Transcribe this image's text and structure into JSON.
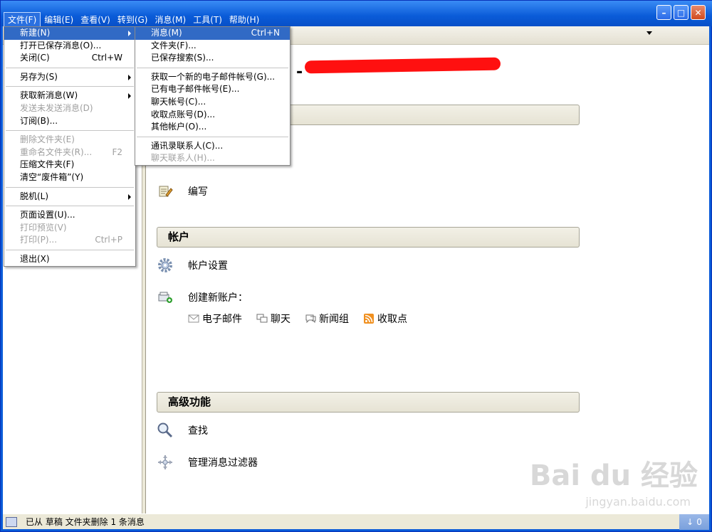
{
  "menubar": [
    {
      "label": "文件(F)",
      "active": true
    },
    {
      "label": "编辑(E)"
    },
    {
      "label": "查看(V)"
    },
    {
      "label": "转到(G)"
    },
    {
      "label": "消息(M)"
    },
    {
      "label": "工具(T)"
    },
    {
      "label": "帮助(H)"
    }
  ],
  "file_menu": {
    "new": "新建(N)",
    "open_saved": "打开已保存消息(O)...",
    "close": "关闭(C)",
    "close_acc": "Ctrl+W",
    "save_as": "另存为(S)",
    "get_new": "获取新消息(W)",
    "send_unsent": "发送未发送消息(D)",
    "subscribe": "订阅(B)...",
    "delete_folder": "删除文件夹(E)",
    "rename_folder": "重命名文件夹(R)...",
    "rename_acc": "F2",
    "compact_folders": "压缩文件夹(F)",
    "empty_trash": "清空“废件箱”(Y)",
    "offline": "脱机(L)",
    "page_setup": "页面设置(U)...",
    "print_preview": "打印预览(V)",
    "print": "打印(P)...",
    "print_acc": "Ctrl+P",
    "exit": "退出(X)"
  },
  "new_menu": {
    "message": "消息(M)",
    "message_acc": "Ctrl+N",
    "folder": "文件夹(F)...",
    "saved_search": "已保存搜索(S)...",
    "get_email_account": "获取一个新的电子邮件帐号(G)...",
    "existing_email": "已有电子邮件帐号(E)...",
    "chat_account": "聊天帐号(C)...",
    "feed_account": "收取点账号(D)...",
    "other_account": "其他帐户(O)...",
    "address_contact": "通讯录联系人(C)...",
    "chat_contact": "聊天联系人(H)..."
  },
  "content": {
    "account_title_prefix": "-",
    "compose_label": "编写",
    "accounts_header": "帐户",
    "account_settings": "帐户设置",
    "create_new_account": "创建新账户：",
    "sub_email": "电子邮件",
    "sub_chat": "聊天",
    "sub_newsgroup": "新闻组",
    "sub_feed": "收取点",
    "advanced_header": "高级功能",
    "search": "查找",
    "manage_filters": "管理消息过滤器"
  },
  "status": {
    "text": "已从 草稿 文件夹删除 1 条消息"
  },
  "watermark": {
    "main": "Bai du 经验",
    "sub": "jingyan.baidu.com"
  }
}
